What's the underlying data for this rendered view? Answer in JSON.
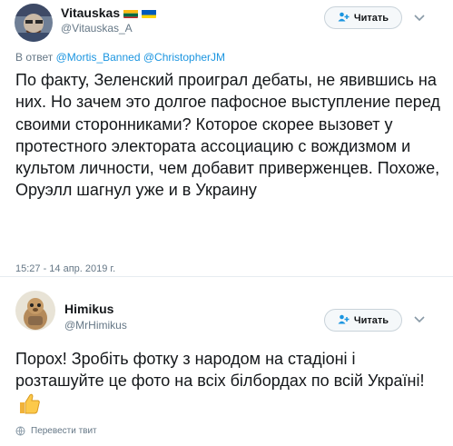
{
  "tweets": [
    {
      "display_name": "Vitauskas",
      "handle": "@Vitauskas_A",
      "flags": [
        "lithuania-flag",
        "ukraine-flag"
      ],
      "follow_label": "Читать",
      "reply_prefix": "В ответ ",
      "reply_mentions": [
        "@Mortis_Banned",
        "@ChristopherJM"
      ],
      "reply_joiner": " ",
      "text": "По факту, Зеленский проиграл дебаты, не явившись на них. Но зачем это долгое пафосное выступление перед своими сторонниками? Которое скорее вызовет у протестного электората ассоциацию с вождизмом и культом личности, чем добавит приверженцев. Похоже, Оруэлл шагнул уже и в Украину",
      "timestamp": "15:27 - 14 апр. 2019 г."
    },
    {
      "display_name": "Himikus",
      "handle": "@MrHimikus",
      "follow_label": "Читать",
      "text": "Порох! Зробіть фотку з народом на стадіоні і розташуйте це фото на всіх білбордах по всій Україні!",
      "emoji": "thumbs-up",
      "translate_label": "Перевести твит"
    }
  ],
  "colors": {
    "link": "#1b95e0",
    "secondary_text": "#657786",
    "primary_text": "#14171a",
    "divider": "#e6ecf0",
    "button_border": "#c9d3da"
  }
}
